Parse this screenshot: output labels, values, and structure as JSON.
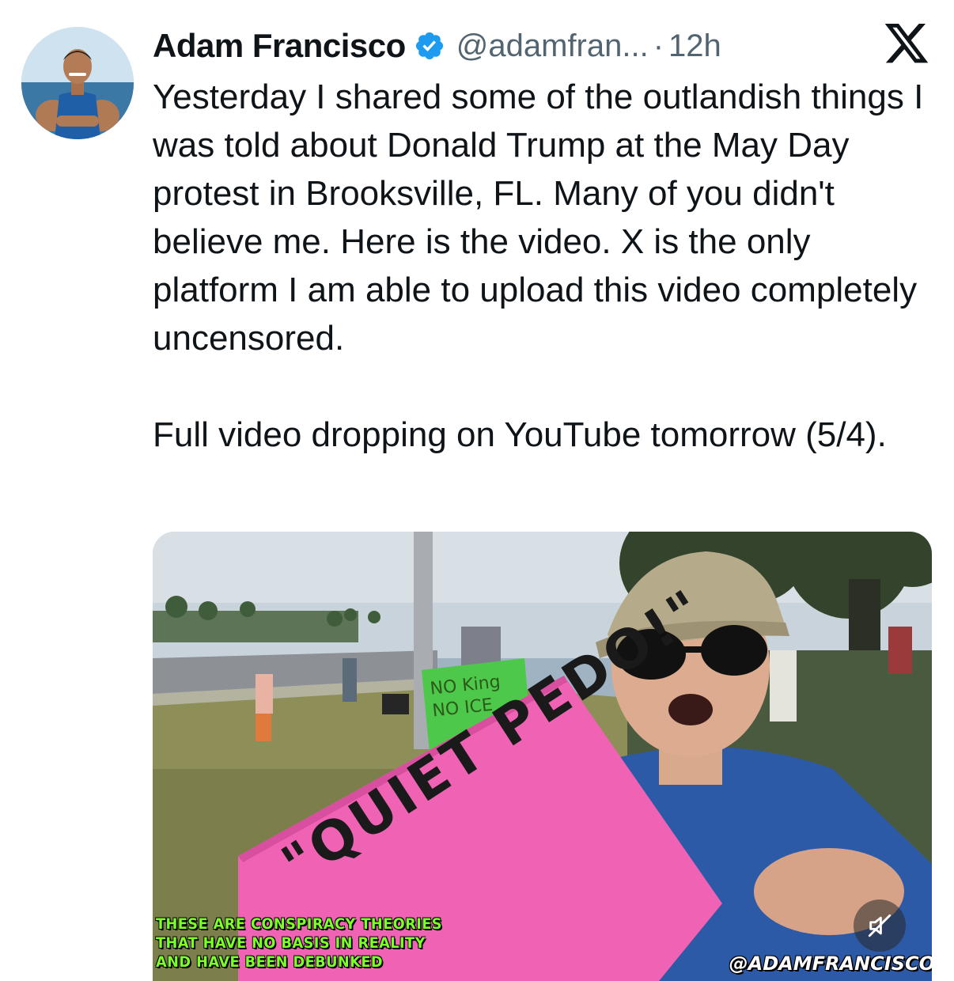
{
  "tweet": {
    "author_name": "Adam Francisco",
    "handle": "@adamfran...",
    "separator": "·",
    "time": "12h",
    "paragraphs": [
      "Yesterday I shared some of the outlandish things I was told about Donald Trump at the May Day protest in Brooksville, FL. Many of you didn't believe me. Here is the video. X is the only platform I am able to upload this video completely uncensored.",
      "Full video dropping on YouTube tomorrow (5/4)."
    ]
  },
  "video": {
    "caption_lines": [
      "THESE ARE CONSPIRACY THEORIES",
      "THAT HAVE NO BASIS IN REALITY",
      "AND HAVE BEEN DEBUNKED"
    ],
    "watermark": "@ADAMFRANCISCO",
    "sign_main": "\"QUIET PEDO!\"",
    "sign_small": "NO King NO ICE"
  },
  "icons": {
    "verified": "verified-badge-icon",
    "platform": "x-logo-icon",
    "mute": "muted-speaker-icon"
  },
  "colors": {
    "text": "#0f1419",
    "secondary": "#536471",
    "verified": "#1d9bf0",
    "caption": "#7fff2a",
    "sign": "#f062b4"
  }
}
